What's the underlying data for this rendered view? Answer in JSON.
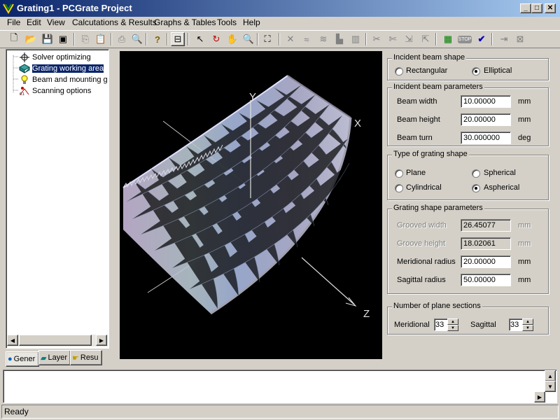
{
  "window": {
    "title": "Grating1 - PCGrate Project"
  },
  "menu": [
    "File",
    "Edit",
    "View",
    "Calcutations & Results",
    "Graphs & Tables",
    "Tools",
    "Help"
  ],
  "tree": {
    "items": [
      {
        "label": "Solver optimizing",
        "icon": "crosshair-icon"
      },
      {
        "label": "Grating working area",
        "icon": "grating-icon"
      },
      {
        "label": "Beam and mounting g",
        "icon": "bulb-icon"
      },
      {
        "label": "Scanning options",
        "icon": "scan-icon"
      }
    ],
    "selected": 1
  },
  "tabs": [
    "Gener",
    "Layer",
    "Resu"
  ],
  "viewport": {
    "axis_x": "X",
    "axis_y": "Y",
    "axis_z": "Z"
  },
  "incident_shape": {
    "title": "Incident beam shape",
    "options": [
      "Rectangular",
      "Elliptical"
    ],
    "selected": "Elliptical"
  },
  "incident_params": {
    "title": "Incident beam parameters",
    "rows": [
      {
        "label": "Beam width",
        "value": "10.00000",
        "unit": "mm"
      },
      {
        "label": "Beam height",
        "value": "20.00000",
        "unit": "mm"
      },
      {
        "label": "Beam turn",
        "value": "30.000000",
        "unit": "deg"
      }
    ]
  },
  "grating_type": {
    "title": "Type of grating shape",
    "options": [
      "Plane",
      "Spherical",
      "Cylindrical",
      "Aspherical"
    ],
    "selected": "Aspherical"
  },
  "grating_params": {
    "title": "Grating shape parameters",
    "rows": [
      {
        "label": "Grooved width",
        "value": "26.45077",
        "unit": "mm",
        "disabled": true
      },
      {
        "label": "Groove height",
        "value": "18.02061",
        "unit": "mm",
        "disabled": true
      },
      {
        "label": "Meridional radius",
        "value": "20.00000",
        "unit": "mm",
        "disabled": false
      },
      {
        "label": "Sagittal radius",
        "value": "50.00000",
        "unit": "mm",
        "disabled": false
      }
    ]
  },
  "plane_sections": {
    "title": "Number of plane sections",
    "meridional_label": "Meridional",
    "meridional_value": "33",
    "sagittal_label": "Sagittal",
    "sagittal_value": "33"
  },
  "status": {
    "text": "Ready"
  }
}
